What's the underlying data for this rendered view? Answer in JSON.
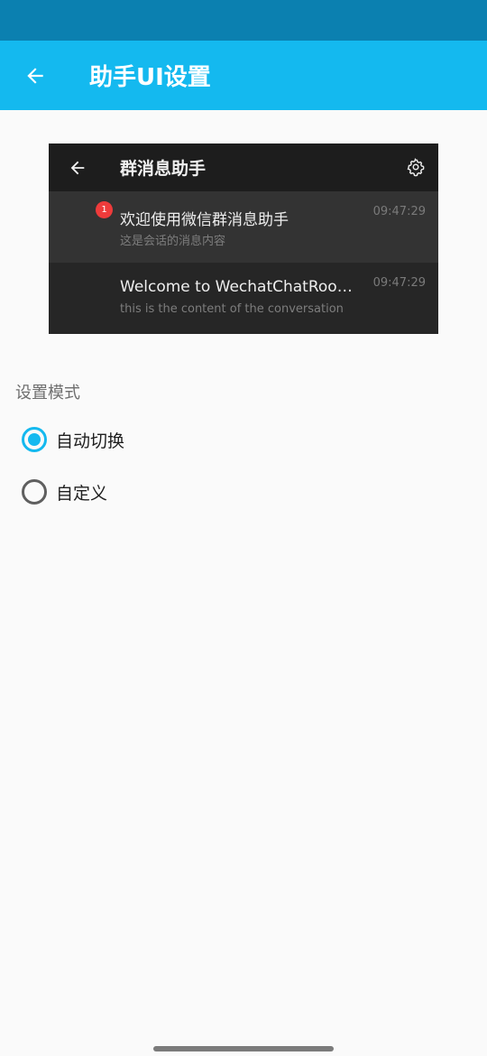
{
  "app_bar": {
    "title": "助手UI设置",
    "icon": "arrow-left-icon",
    "background": "#14b9ef"
  },
  "preview": {
    "toolbar_title": "群消息助手",
    "back_icon": "arrow-left-icon",
    "settings_icon": "gear-icon",
    "rows": [
      {
        "name": "欢迎使用微信群消息助手",
        "message": "这是会话的消息内容",
        "time": "09:47:29",
        "badge": "1"
      },
      {
        "name": "Welcome to WechatChatRoom…",
        "message": "this is the content of the conversation",
        "time": "09:47:29"
      }
    ]
  },
  "settings": {
    "section_label": "设置模式",
    "options": [
      {
        "label": "自动切换",
        "selected": true
      },
      {
        "label": "自定义",
        "selected": false
      }
    ],
    "accent": "#14b9ef"
  }
}
